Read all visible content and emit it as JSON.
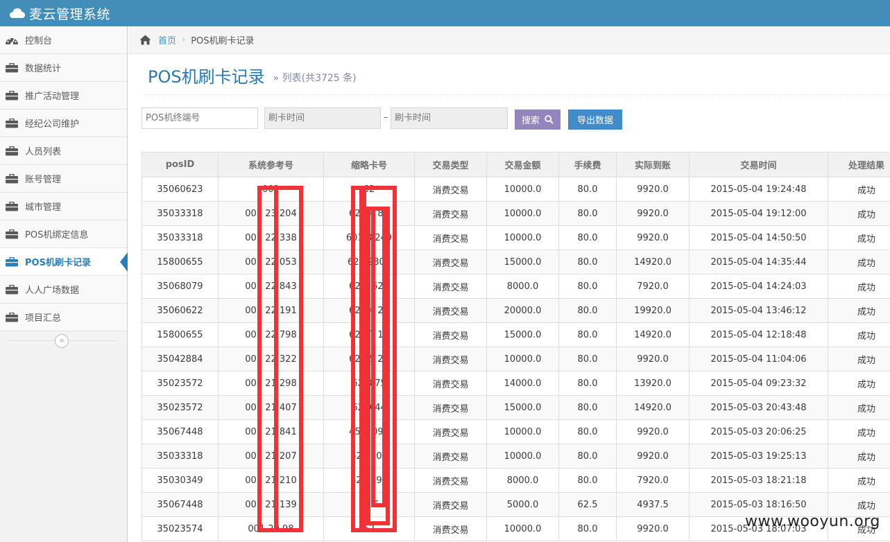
{
  "app": {
    "title": "麦云管理系统",
    "icon": "cloud-icon"
  },
  "sidebar": {
    "items": [
      {
        "label": "控制台",
        "icon": "dashboard-icon",
        "active": false
      },
      {
        "label": "数据统计",
        "icon": "briefcase-icon",
        "active": false
      },
      {
        "label": "推广活动管理",
        "icon": "briefcase-icon",
        "active": false
      },
      {
        "label": "经纪公司维护",
        "icon": "briefcase-icon",
        "active": false
      },
      {
        "label": "人员列表",
        "icon": "briefcase-icon",
        "active": false
      },
      {
        "label": "账号管理",
        "icon": "briefcase-icon",
        "active": false
      },
      {
        "label": "城市管理",
        "icon": "briefcase-icon",
        "active": false
      },
      {
        "label": "POS机绑定信息",
        "icon": "briefcase-icon",
        "active": false
      },
      {
        "label": "POS机刷卡记录",
        "icon": "briefcase-icon",
        "active": true
      },
      {
        "label": "人人广场数据",
        "icon": "briefcase-icon",
        "active": false
      },
      {
        "label": "项目汇总",
        "icon": "briefcase-icon",
        "active": false
      }
    ],
    "collapse_glyph": "«"
  },
  "breadcrumb": {
    "home": "首页",
    "separator": "›",
    "current": "POS机刷卡记录"
  },
  "header": {
    "title": "POS机刷卡记录",
    "subtitle": "» 列表(共3725 条)"
  },
  "search": {
    "terminal_placeholder": "POS机终端号",
    "time_from_placeholder": "刷卡时间",
    "time_to_placeholder": "刷卡时间",
    "dash": "–",
    "search_label": "搜索",
    "export_label": "导出数据"
  },
  "table": {
    "columns": [
      "posID",
      "系统参考号",
      "缩略卡号",
      "交易类型",
      "交易金额",
      "手续费",
      "实际到账",
      "交易时间",
      "处理结果"
    ],
    "rows": [
      [
        "35060623",
        "001",
        "62",
        "消费交易",
        "10000.0",
        "80.0",
        "9920.0",
        "2015-05-04 19:24:48",
        "成功"
      ],
      [
        "35033318",
        "001 23 204",
        "622 4 88",
        "消费交易",
        "10000.0",
        "80.0",
        "9920.0",
        "2015-05-04 19:12:00",
        "成功"
      ],
      [
        "35033318",
        "001 22 338",
        "601 8 249",
        "消费交易",
        "10000.0",
        "80.0",
        "9920.0",
        "2015-05-04 14:50:50",
        "成功"
      ],
      [
        "15800655",
        "001 22 053",
        "622 2800",
        "消费交易",
        "15000.0",
        "80.0",
        "14920.0",
        "2015-05-04 14:35:44",
        "成功"
      ],
      [
        "35068079",
        "001 22 843",
        "62 8 623",
        "消费交易",
        "8000.0",
        "80.0",
        "7920.0",
        "2015-05-04 14:24:03",
        "成功"
      ],
      [
        "35060622",
        "001 22 191",
        "622 4 21",
        "消费交易",
        "20000.0",
        "80.0",
        "19920.0",
        "2015-05-04 13:46:12",
        "成功"
      ],
      [
        "15800655",
        "001 22 798",
        "622 7 18",
        "消费交易",
        "15000.0",
        "80.0",
        "14920.0",
        "2015-05-04 12:18:48",
        "成功"
      ],
      [
        "35042884",
        "001 22 322",
        "622 5 26",
        "消费交易",
        "10000.0",
        "80.0",
        "9920.0",
        "2015-05-04 11:04:06",
        "成功"
      ],
      [
        "35023572",
        "001 21 298",
        "62 8 75",
        "消费交易",
        "14000.0",
        "80.0",
        "13920.0",
        "2015-05-04 09:23:32",
        "成功"
      ],
      [
        "35023572",
        "001 21 407",
        "62 9 44",
        "消费交易",
        "15000.0",
        "80.0",
        "14920.0",
        "2015-05-03 20:43:48",
        "成功"
      ],
      [
        "35067448",
        "001 21 841",
        "45 1 091",
        "消费交易",
        "10000.0",
        "80.0",
        "9920.0",
        "2015-05-03 20:06:25",
        "成功"
      ],
      [
        "35033318",
        "001 21 207",
        "62 0703",
        "消费交易",
        "10000.0",
        "80.0",
        "9920.0",
        "2015-05-03 19:25:13",
        "成功"
      ],
      [
        "35030349",
        "001 21 210",
        "62 0091",
        "消费交易",
        "8000.0",
        "80.0",
        "7920.0",
        "2015-05-03 18:21:18",
        "成功"
      ],
      [
        "35067448",
        "001 21 139",
        "62 6",
        "消费交易",
        "5000.0",
        "62.5",
        "4937.5",
        "2015-05-03 18:16:50",
        "成功"
      ],
      [
        "35023574",
        "001 20 98",
        "62",
        "消费交易",
        "10000.0",
        "80.0",
        "9920.0",
        "2015-05-03 18:07:03",
        "成功"
      ]
    ]
  },
  "watermark": "www.wooyun.org",
  "colors": {
    "topbar": "#438eb9",
    "accent": "#2b7dbc",
    "search_button": "#9585bf",
    "export_button": "#428bca",
    "redaction": "#f03236"
  }
}
